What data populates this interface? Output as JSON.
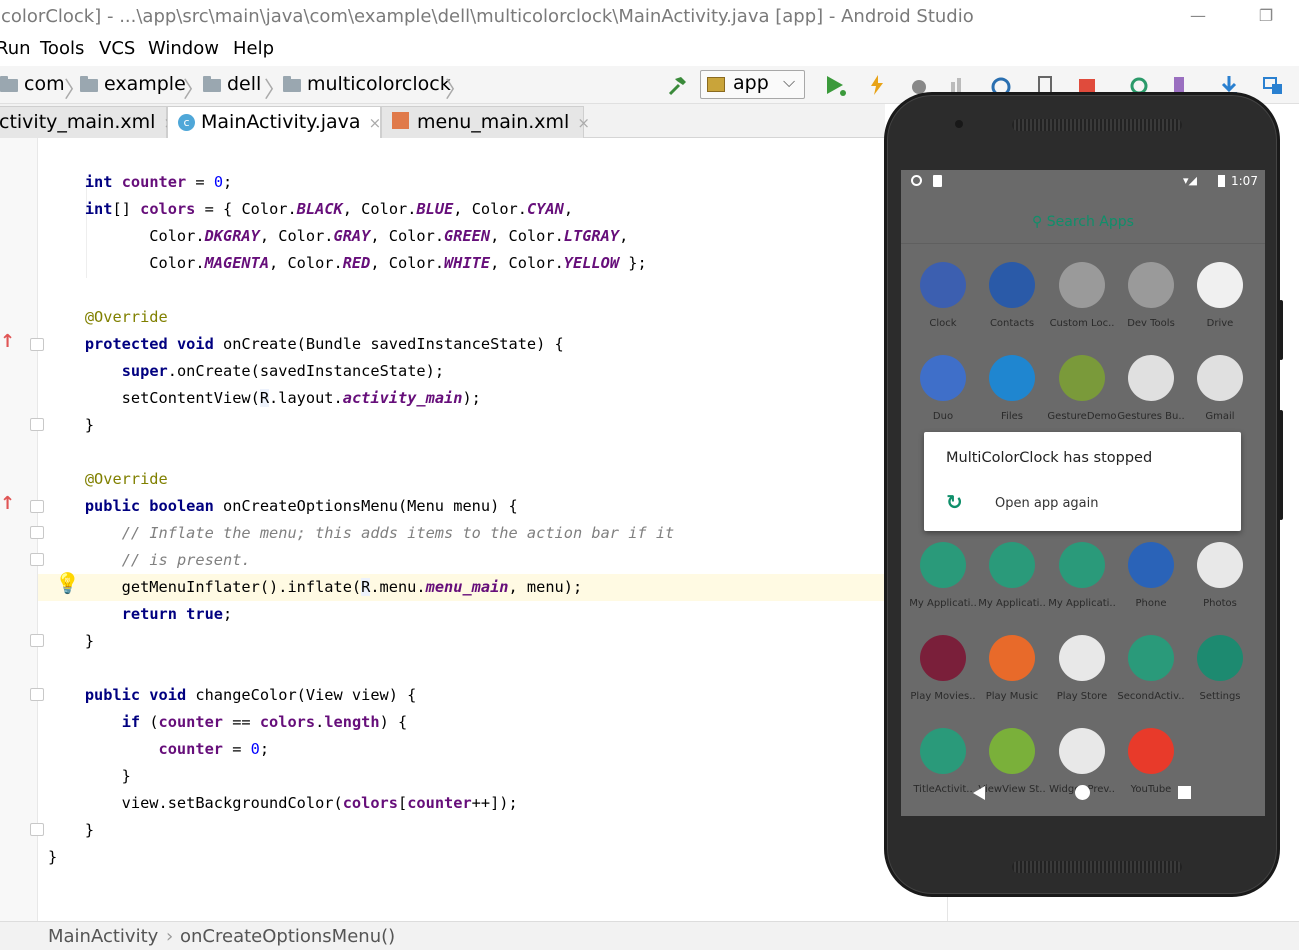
{
  "window": {
    "title": "icolorClock] - ...\\app\\src\\main\\java\\com\\example\\dell\\multicolorclock\\MainActivity.java [app] - Android Studio",
    "minimize": "—",
    "maximize": "❐"
  },
  "menu": [
    "Run",
    "Tools",
    "VCS",
    "Window",
    "Help"
  ],
  "breadcrumb": [
    "com",
    "example",
    "dell",
    "multicolorclock"
  ],
  "toolbar": {
    "run_config": "app"
  },
  "tabs": [
    {
      "label": "ctivity_main.xml",
      "close": "×"
    },
    {
      "label": "MainActivity.java",
      "close": "×"
    },
    {
      "label": "menu_main.xml",
      "close": "×"
    }
  ],
  "status": {
    "class": "MainActivity",
    "sep": "›",
    "method": "onCreateOptionsMenu()"
  },
  "emulator": {
    "time": "1:07",
    "search": "Search Apps",
    "apps": [
      "Clock",
      "Contacts",
      "Custom Loc..",
      "Dev Tools",
      "Drive",
      "Duo",
      "Files",
      "GestureDemo",
      "Gestures Bu..",
      "Gmail",
      "My Applicati..",
      "My Applicati..",
      "My Applicati..",
      "Phone",
      "Photos",
      "Play Movies..",
      "Play Music",
      "Play Store",
      "SecondActiv..",
      "Settings",
      "TitleActivit..",
      "ViewView St..",
      "Widget Prev..",
      "YouTube"
    ],
    "dialog": {
      "title": "MultiColorClock has stopped",
      "action": "Open app again"
    }
  },
  "colors": {
    "keyword": "#000080",
    "field": "#660e7a",
    "annotation": "#808000",
    "comment": "#808080",
    "accent": "#0f8f6a"
  }
}
